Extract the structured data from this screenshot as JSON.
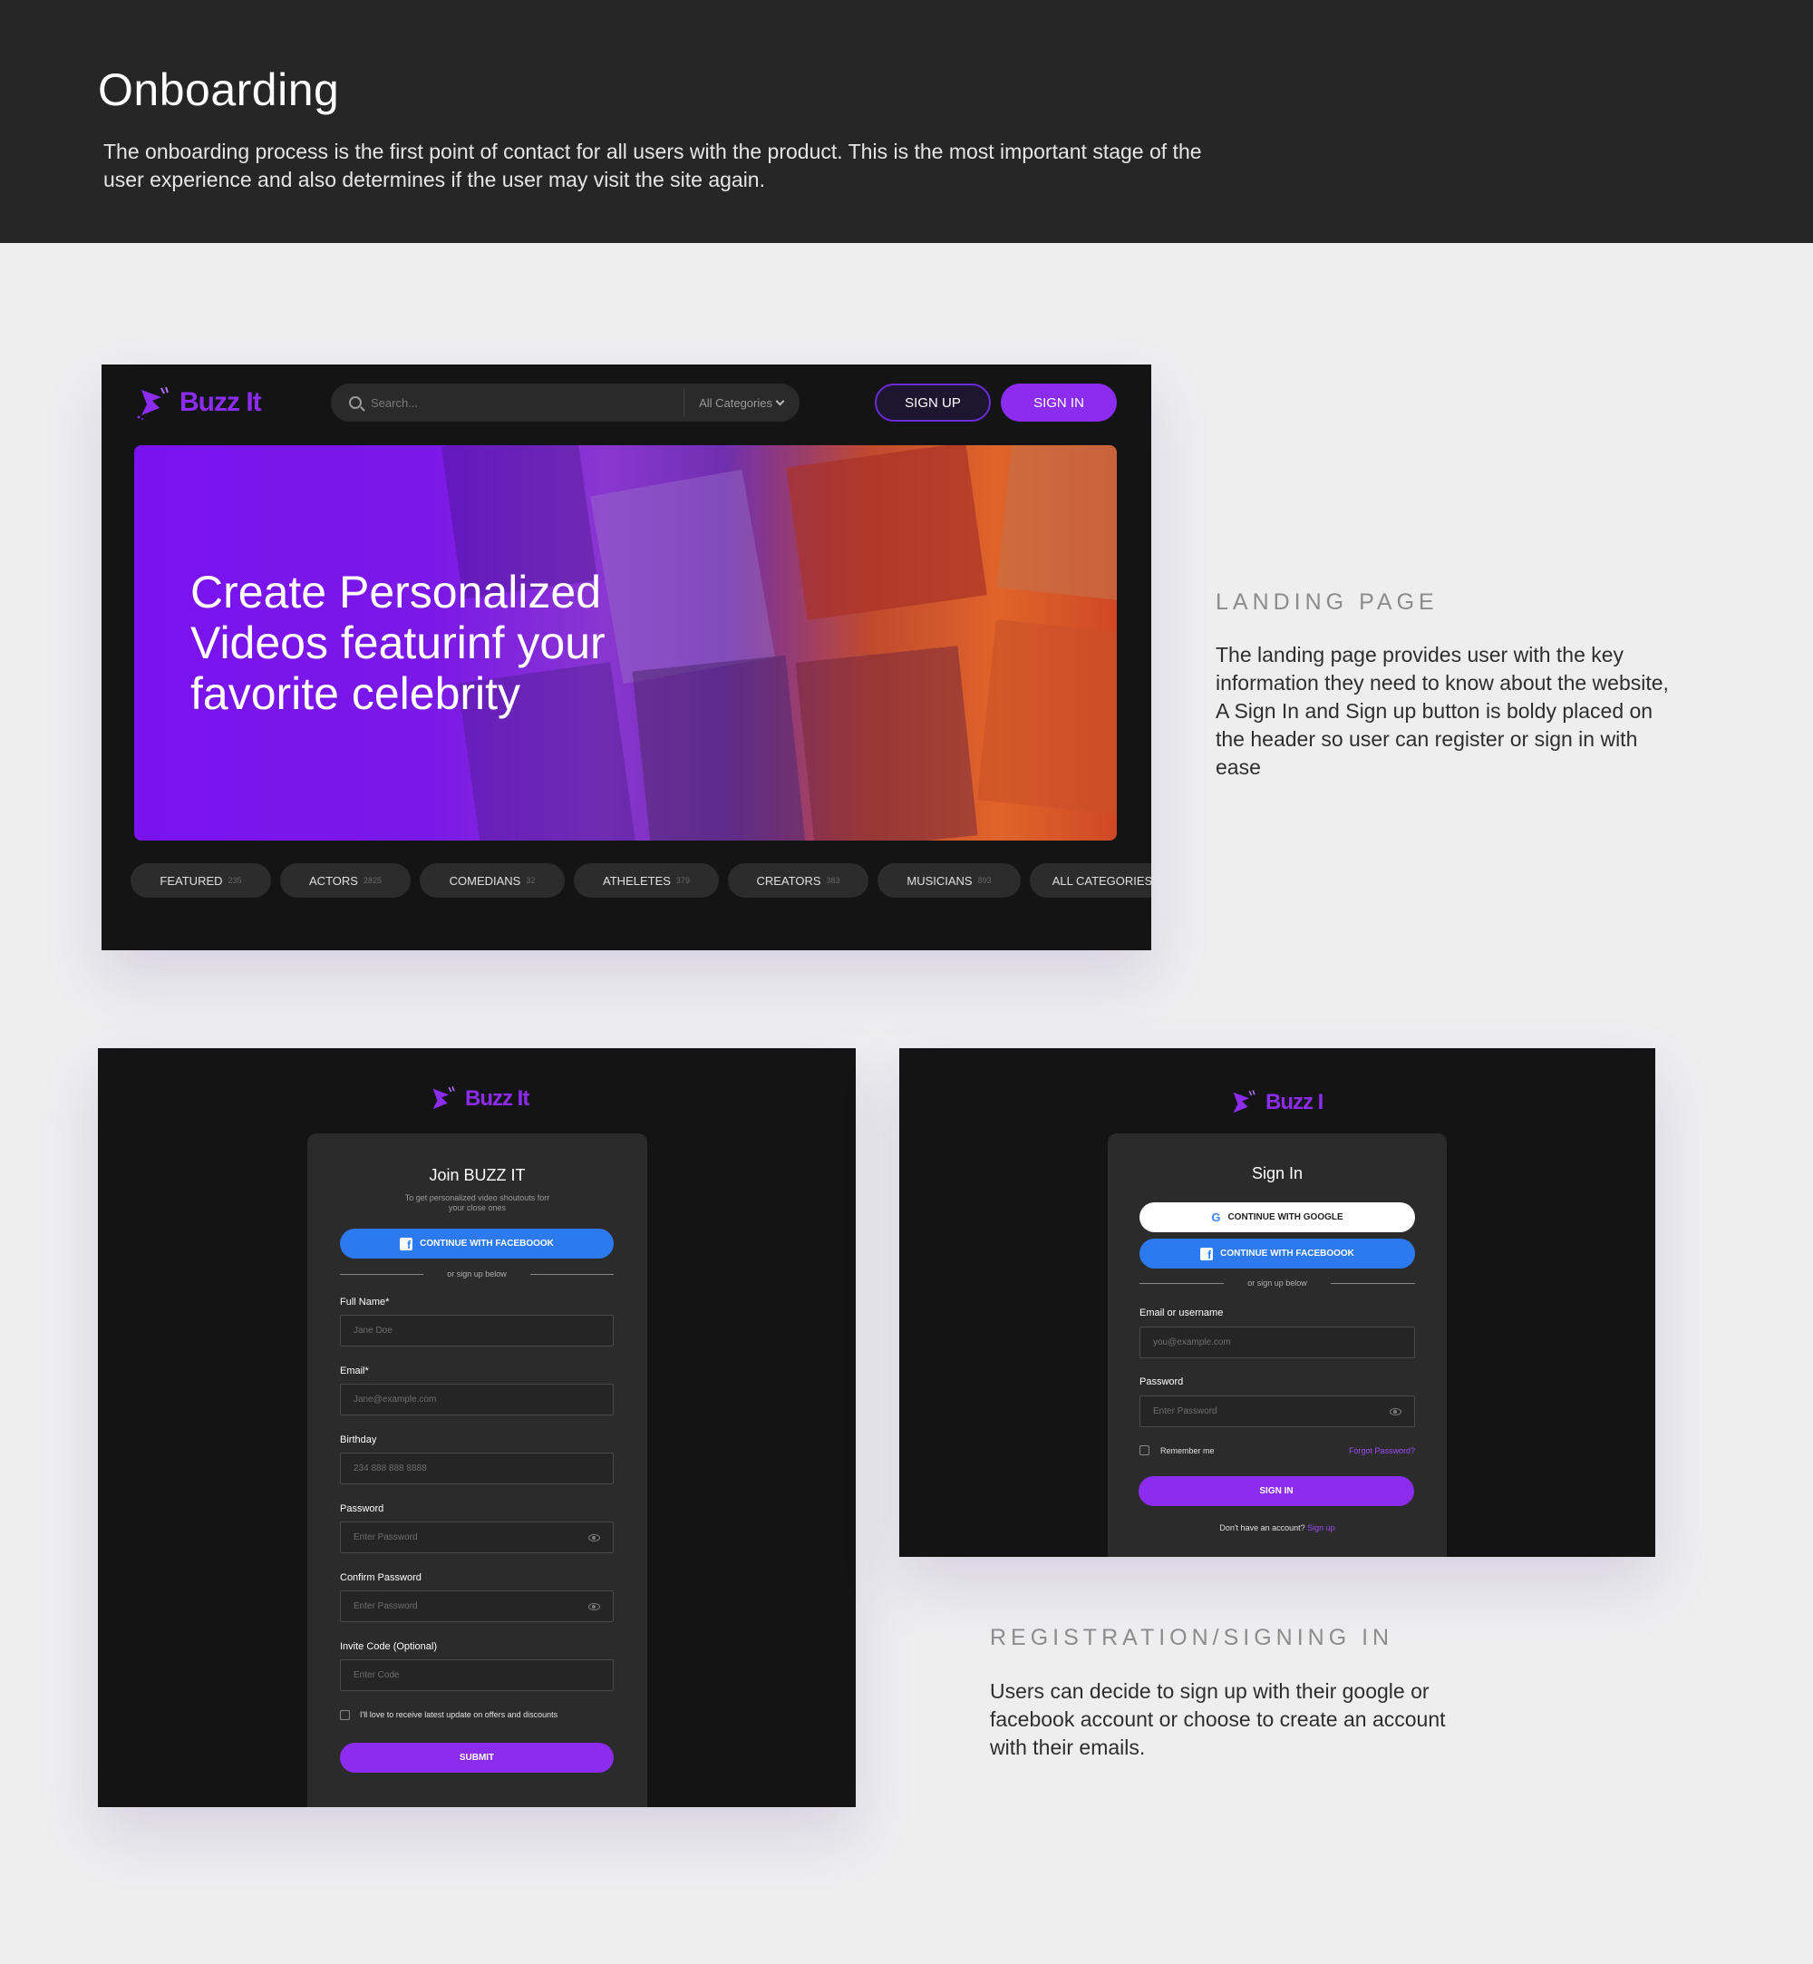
{
  "header": {
    "title": "Onboarding",
    "description": "The onboarding process is the first point of contact for all users with the product. This is the most important stage of the user experience and also determines if the user may visit the site again."
  },
  "brand": {
    "name": "Buzz It",
    "name_cut": "Buzz I",
    "accent": "#8b2cf0",
    "facebook_blue": "#2d7af0"
  },
  "landing": {
    "search_placeholder": "Search...",
    "category_select": "All Categories",
    "signup_label": "SIGN UP",
    "signin_label": "SIGN IN",
    "hero_title": "Create Personalized Videos featurinf your favorite celebrity",
    "categories": [
      {
        "label": "FEATURED",
        "count": "235"
      },
      {
        "label": "ACTORS",
        "count": "2825"
      },
      {
        "label": "COMEDIANS",
        "count": "32"
      },
      {
        "label": "ATHELETES",
        "count": "379"
      },
      {
        "label": "CREATORS",
        "count": "383"
      },
      {
        "label": "MUSICIANS",
        "count": "893"
      },
      {
        "label": "ALL CATEGORIES",
        "count": ""
      }
    ]
  },
  "landing_section": {
    "label": "LANDING PAGE",
    "body": "The landing page provides user with the key information they need to know about the website, A Sign In and Sign up button is boldy placed on the header so user can register or sign in with ease"
  },
  "register": {
    "title": "Join BUZZ IT",
    "subtitle_line1": "To get personalized video shoutouts forr",
    "subtitle_line2": "your close ones",
    "facebook_btn": "CONTINUE WITH FACEBOOOK",
    "or_text": "or sign up below",
    "fields": [
      {
        "label": "Full Name*",
        "placeholder": "Jane Doe"
      },
      {
        "label": "Email*",
        "placeholder": "Jane@example.com"
      },
      {
        "label": "Birthday",
        "placeholder": "234 888 888 8888"
      },
      {
        "label": "Password",
        "placeholder": "Enter Password"
      },
      {
        "label": "Confirm Password",
        "placeholder": "Enter Password"
      },
      {
        "label": "Invite Code (Optional)",
        "placeholder": "Enter Code"
      }
    ],
    "newsletter": "I'll love to receive latest update on offers and discounts",
    "submit": "SUBMIT"
  },
  "signin": {
    "title": "Sign In",
    "google_btn": "CONTINUE WITH GOOGLE",
    "facebook_btn": "CONTINUE WITH FACEBOOOK",
    "or_text": "or sign up below",
    "email_label": "Email or username",
    "email_placeholder": "you@example.com",
    "password_label": "Password",
    "password_placeholder": "Enter Password",
    "remember": "Remember me",
    "forgot": "Forgot Password?",
    "submit": "SIGN IN",
    "no_account": "Don't have an account?",
    "signup_link": "Sign up"
  },
  "registration_section": {
    "label": "REGISTRATION/SIGNING IN",
    "body": "Users can decide to sign up with their google or facebook account or choose to create an account with their emails."
  }
}
